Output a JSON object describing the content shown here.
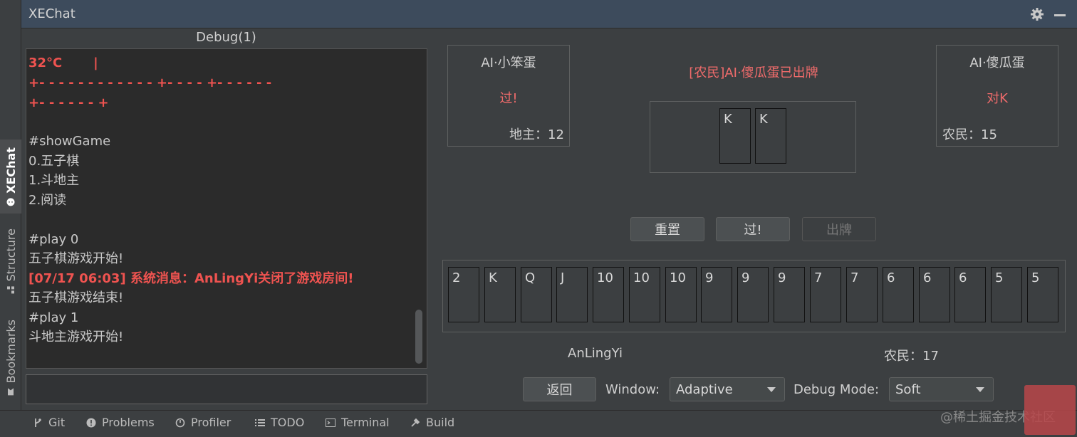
{
  "window": {
    "title": "XEChat"
  },
  "side_tabs": [
    {
      "label": "XEChat",
      "icon": "chat-icon"
    },
    {
      "label": "Structure",
      "icon": "structure-icon"
    },
    {
      "label": "Bookmarks",
      "icon": "bookmark-icon"
    }
  ],
  "debug": {
    "title": "Debug(1)",
    "lines": [
      {
        "text": "32°C       |",
        "style": "red"
      },
      {
        "text": "+- - - - - - - - - - - - +- - - - +- - - - - -",
        "style": "red"
      },
      {
        "text": "+- - - - - - +",
        "style": "red"
      },
      {
        "text": "",
        "style": "normal"
      },
      {
        "text": "#showGame",
        "style": "normal"
      },
      {
        "text": "0.五子棋",
        "style": "normal"
      },
      {
        "text": "1.斗地主",
        "style": "normal"
      },
      {
        "text": "2.阅读",
        "style": "normal"
      },
      {
        "text": "",
        "style": "normal"
      },
      {
        "text": "#play 0",
        "style": "normal"
      },
      {
        "text": "五子棋游戏开始!",
        "style": "normal"
      },
      {
        "text": "[07/17 06:03] 系统消息：AnLingYi关闭了游戏房间!",
        "style": "red"
      },
      {
        "text": "五子棋游戏结束!",
        "style": "normal"
      },
      {
        "text": "#play 1",
        "style": "normal"
      },
      {
        "text": "斗地主游戏开始!",
        "style": "normal"
      }
    ],
    "input_value": ""
  },
  "game": {
    "left_player": {
      "name": "AI·小笨蛋",
      "status": "过!",
      "count": "地主：12"
    },
    "right_player": {
      "name": "AI·傻瓜蛋",
      "status": "对K",
      "count": "农民：15"
    },
    "last_play_text": "[农民]AI·傻瓜蛋已出牌",
    "table_cards": [
      "K",
      "K"
    ],
    "buttons": {
      "reset": "重置",
      "pass": "过!",
      "play": "出牌"
    },
    "hand_cards": [
      "2",
      "K",
      "Q",
      "J",
      "10",
      "10",
      "10",
      "9",
      "9",
      "9",
      "7",
      "7",
      "6",
      "6",
      "6",
      "5",
      "5"
    ],
    "self_player": {
      "name": "AnLingYi",
      "count": "农民：17"
    }
  },
  "controls": {
    "back_label": "返回",
    "window_label": "Window:",
    "window_value": "Adaptive",
    "debug_mode_label": "Debug Mode:",
    "debug_mode_value": "Soft"
  },
  "bottom_bar": [
    {
      "label": "Git",
      "icon": "git-icon"
    },
    {
      "label": "Problems",
      "icon": "problems-icon"
    },
    {
      "label": "Profiler",
      "icon": "profiler-icon"
    },
    {
      "label": "TODO",
      "icon": "todo-icon"
    },
    {
      "label": "Terminal",
      "icon": "terminal-icon"
    },
    {
      "label": "Build",
      "icon": "build-icon"
    }
  ],
  "watermark": "@稀土掘金技术社区"
}
